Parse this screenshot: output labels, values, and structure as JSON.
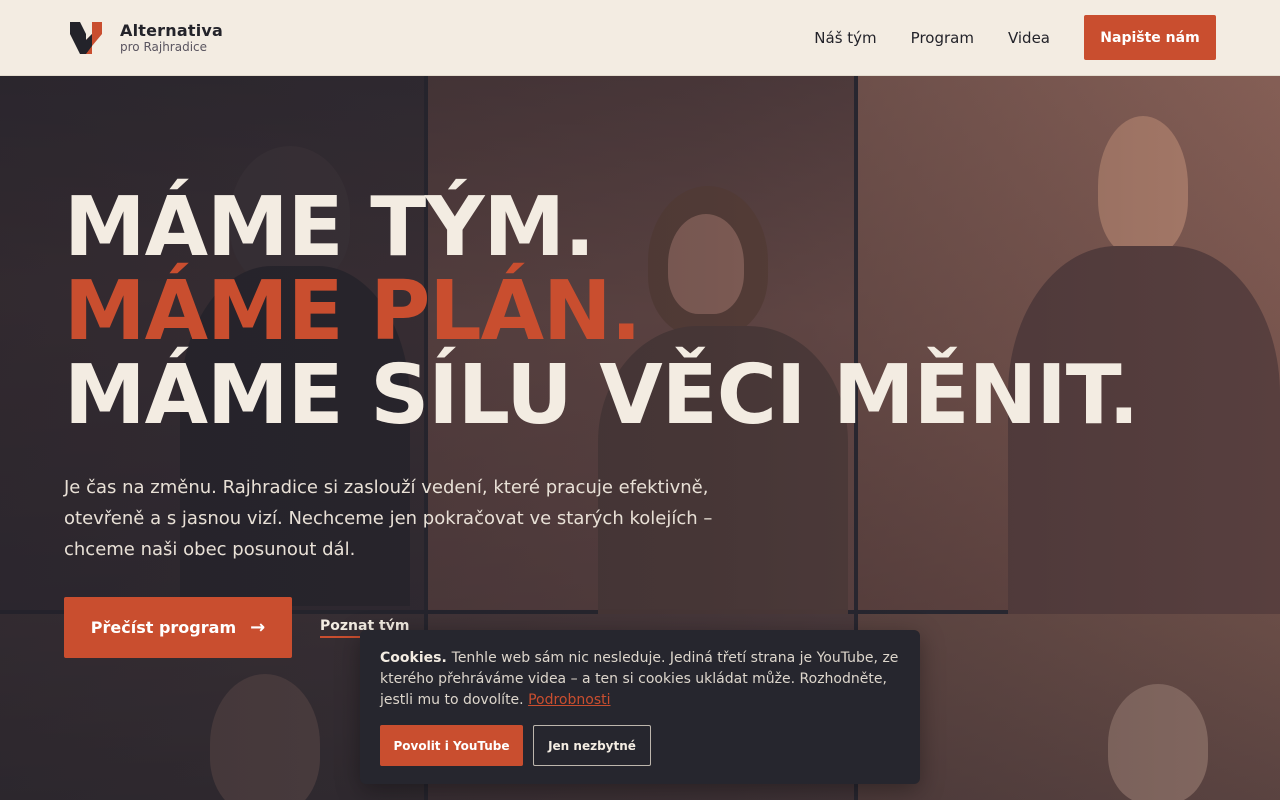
{
  "brand": {
    "name": "Alternativa",
    "subtitle": "pro Rajhradice",
    "logo_icon": "v-chevron-logo-icon"
  },
  "nav": {
    "items": [
      {
        "label": "Náš tým"
      },
      {
        "label": "Program"
      },
      {
        "label": "Videa"
      }
    ],
    "cta_label": "Napište nám"
  },
  "hero": {
    "headline_1": "MÁME TÝM.",
    "headline_2": "MÁME PLÁN.",
    "headline_3": "MÁME SÍLU VĚCI MĚNIT.",
    "lead": "Je čas na změnu. Rajhradice si zaslouží vedení, které pracuje efektivně, otevřeně a s jasnou vizí. Nechceme jen pokračovat ve starých kolejích – chceme naši obec posunout dál.",
    "primary_button": "Přečíst program",
    "primary_button_icon": "arrow-right-icon",
    "secondary_link": "Poznat tým"
  },
  "cookie": {
    "title": "Cookies.",
    "text": "Tenhle web sám nic nesleduje. Jediná třetí strana je YouTube, ze kterého přehráváme videa – a ten si cookies ukládat může. Rozhodněte, jestli mu to dovolíte.",
    "details_link": "Podrobnosti",
    "accept_button": "Povolit i YouTube",
    "necessary_button": "Jen nezbytné"
  },
  "colors": {
    "accent": "#c94e2f",
    "header_bg": "#f3ece2",
    "dark": "#26262e"
  }
}
